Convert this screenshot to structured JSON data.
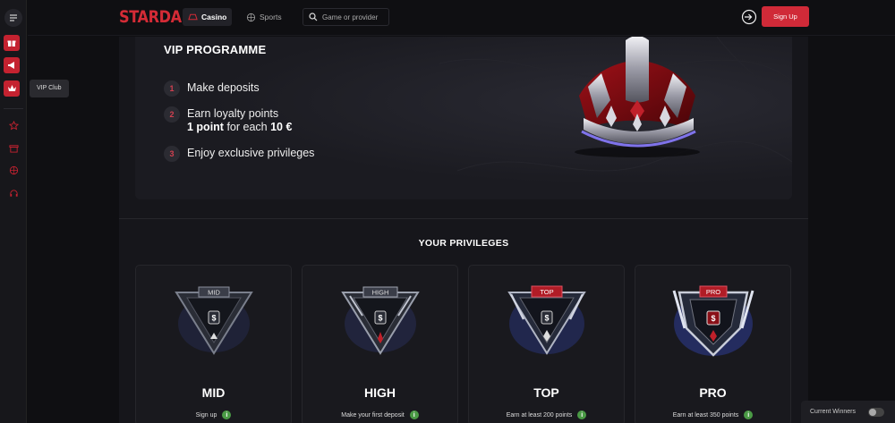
{
  "header": {
    "logo": "STARDA",
    "tabs": [
      {
        "label": "Casino",
        "icon": "casino-icon"
      },
      {
        "label": "Sports",
        "icon": "ball-icon"
      }
    ],
    "search": {
      "placeholder": "Game or provider"
    },
    "signup_label": "Sign Up"
  },
  "sidebar": {
    "tooltip": "VIP Club",
    "items": [
      "menu-icon",
      "gift-icon",
      "megaphone-icon",
      "crown-icon",
      "star-icon",
      "gift-box-icon",
      "ball-icon",
      "headset-icon"
    ]
  },
  "hero": {
    "title": "VIP PROGRAMME",
    "steps": [
      {
        "num": "1",
        "text": "Make deposits"
      },
      {
        "num": "2",
        "text": "Earn loyalty points",
        "sub_bold": "1 point",
        "sub_rest": " for each ",
        "sub_bold2": "10 €"
      },
      {
        "num": "3",
        "text": "Enjoy exclusive privileges"
      }
    ]
  },
  "privileges": {
    "title": "YOUR PRIVILEGES",
    "cards": [
      {
        "badge": "MID",
        "name": "MID",
        "desc": "Sign up"
      },
      {
        "badge": "HIGH",
        "name": "HIGH",
        "desc": "Make your first deposit"
      },
      {
        "badge": "TOP",
        "name": "TOP",
        "desc": "Earn at least 200 points"
      },
      {
        "badge": "PRO",
        "name": "PRO",
        "desc": "Earn at least 350 points"
      }
    ]
  },
  "winners": {
    "label": "Current Winners"
  },
  "colors": {
    "brand": "#d42b36",
    "background": "#0f0f12",
    "card": "#19191e",
    "info": "#4a9a45"
  }
}
